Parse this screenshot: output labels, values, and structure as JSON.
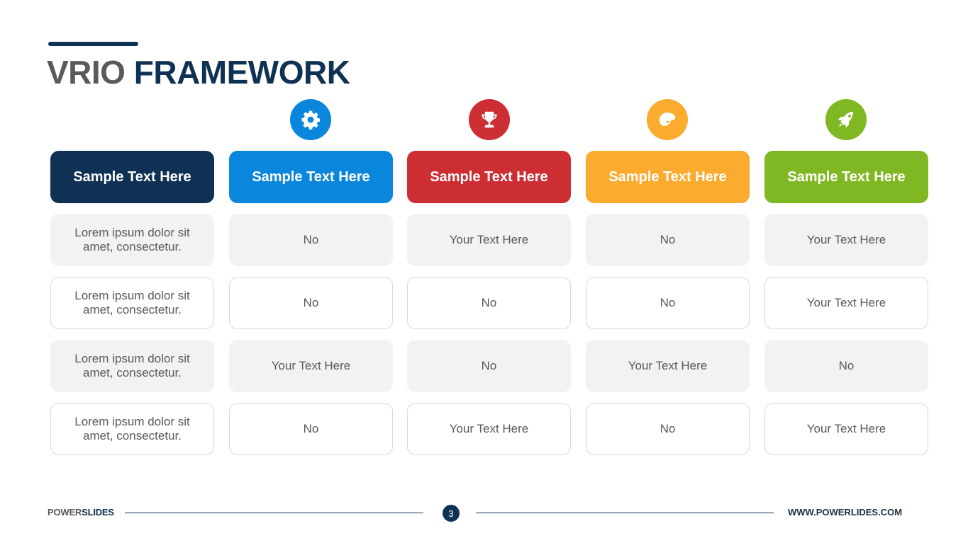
{
  "title": {
    "part1": "VRIO",
    "part2": "FRAMEWORK"
  },
  "colors": {
    "navy": "#0f3154",
    "blue": "#0a86dc",
    "red": "#cc2e33",
    "orange": "#fbab2d",
    "green": "#80b824",
    "cell_text": "#595959"
  },
  "columns": [
    {
      "header": "Sample Text Here",
      "icon": "none",
      "color": "#0f3154",
      "cells": [
        "Lorem ipsum dolor sit amet, consectetur.",
        "Lorem ipsum dolor sit amet, consectetur.",
        "Lorem ipsum dolor sit amet, consectetur.",
        "Lorem ipsum dolor sit amet, consectetur."
      ]
    },
    {
      "header": "Sample Text Here",
      "icon": "gear-icon",
      "color": "#0a86dc",
      "cells": [
        "No",
        "No",
        "Your Text Here",
        "No"
      ]
    },
    {
      "header": "Sample Text Here",
      "icon": "trophy-icon",
      "color": "#cc2e33",
      "cells": [
        "Your Text Here",
        "No",
        "No",
        "Your Text Here"
      ]
    },
    {
      "header": "Sample Text Here",
      "icon": "palette-icon",
      "color": "#fbab2d",
      "cells": [
        "No",
        "No",
        "Your Text Here",
        "No"
      ]
    },
    {
      "header": "Sample Text Here",
      "icon": "rocket-icon",
      "color": "#80b824",
      "cells": [
        "Your Text Here",
        "Your Text Here",
        "No",
        "Your Text Here"
      ]
    }
  ],
  "footer": {
    "brand_part1": "POWER",
    "brand_part2": "SLIDES",
    "page_number": "3",
    "url": "WWW.POWERLIDES.COM"
  }
}
